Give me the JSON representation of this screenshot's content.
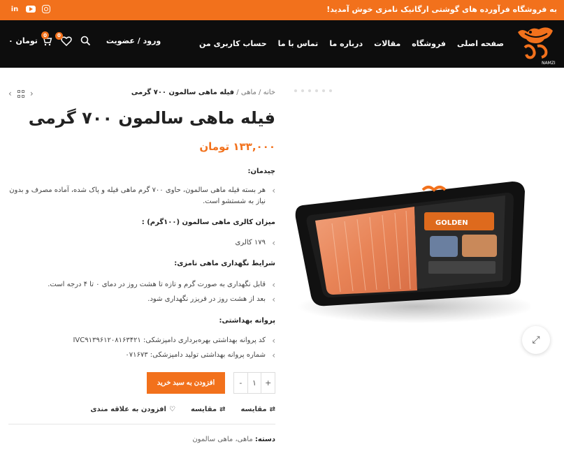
{
  "topbar": {
    "announcement": "به فروشگاه فرآورده های گوشتی ارگانیک نامزی خوش آمدید!",
    "socials": [
      "linkedin-icon",
      "youtube-icon",
      "instagram-icon"
    ]
  },
  "header": {
    "logo_text": "NAMZI",
    "nav": [
      "صفحه اصلی",
      "فروشگاه",
      "مقالات",
      "درباره ما",
      "تماس با ما",
      "حساب کاربری من"
    ],
    "login": "ورود / عضویت",
    "cart_total": "۰ تومان",
    "cart_count": "0",
    "wishlist_count": "0"
  },
  "breadcrumb": {
    "home": "خانه",
    "category": "ماهی",
    "current": "فیله ماهی سالمون ۷۰۰ گرمی"
  },
  "product": {
    "title": "فیله ماهی سالمون ۷۰۰ گرمی",
    "price": "۱۳۳,۰۰۰ تومان",
    "sections": {
      "contents_heading": "چیدمان:",
      "contents_item": "هر بسته فیله ماهی سالمون، حاوی ۷۰۰ گرم ماهی فیله و پاک شده، آماده مصرف و بدون نیاز به شستشو است.",
      "calorie_heading": "میزان کالری ماهی سالمون (۱۰۰گرم) :",
      "calorie_item": "۱۷۹ کالری",
      "storage_heading": "شرایط نگهداری ماهی نامزی:",
      "storage_item_1": "قابل نگهداری به صورت گرم و تازه تا هشت روز در دمای ۰ تا ۴ درجه است.",
      "storage_item_2": "بعد از هشت روز در فریزر نگهداری شود.",
      "license_heading": "پروانه بهداشتی:",
      "license_item_1": "کد پروانه بهداشتی بهره‌برداری دامپزشکی: IVC۹۱۳۹۶۱۲۰۸۱۶۳۴۲۱",
      "license_item_2": "شماره پروانه بهداشتی تولید دامپزشکی: ۰۷۱۶۷۳"
    },
    "quantity": "۱",
    "qty_minus": "-",
    "qty_plus": "+",
    "add_to_cart": "افزودن به سبد خرید",
    "compare_1": "مقایسه",
    "compare_2": "مقایسه",
    "wishlist": "افزودن به علاقه مندی",
    "category_label": "دسته:",
    "category_value": "ماهی، ماهی سالمون",
    "package_label": "GOLDEN",
    "zoom_icon": "expand-icon"
  },
  "colors": {
    "accent": "#f2711c",
    "header_bg": "#0d0d0d"
  }
}
